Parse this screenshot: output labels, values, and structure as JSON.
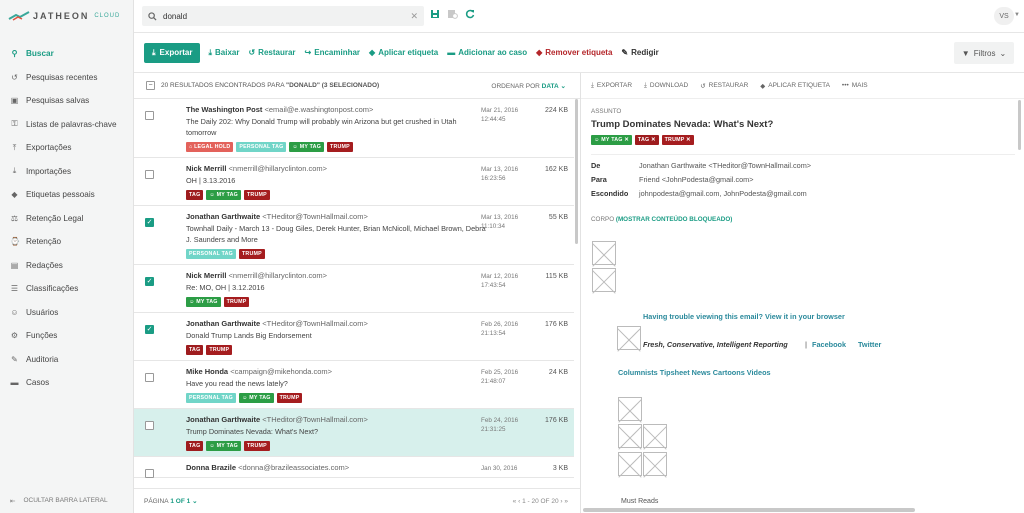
{
  "app": {
    "brand": "JATHEON",
    "brand_sub": "CLOUD",
    "accent": "#1a9c84"
  },
  "sidebar": {
    "items": [
      {
        "label": "Buscar",
        "icon": "search-icon",
        "active": true
      },
      {
        "label": "Pesquisas recentes",
        "icon": "history-icon"
      },
      {
        "label": "Pesquisas salvas",
        "icon": "save-icon"
      },
      {
        "label": "Listas de palavras-chave",
        "icon": "key-icon"
      },
      {
        "label": "Exportações",
        "icon": "export-icon"
      },
      {
        "label": "Importações",
        "icon": "import-icon"
      },
      {
        "label": "Etiquetas pessoais",
        "icon": "tag-icon"
      },
      {
        "label": "Retenção Legal",
        "icon": "legal-hold-icon"
      },
      {
        "label": "Retenção",
        "icon": "retention-icon"
      },
      {
        "label": "Redações",
        "icon": "redaction-icon"
      },
      {
        "label": "Classificações",
        "icon": "classification-icon"
      },
      {
        "label": "Usuários",
        "icon": "users-icon"
      },
      {
        "label": "Funções",
        "icon": "roles-icon"
      },
      {
        "label": "Auditoria",
        "icon": "audit-icon"
      },
      {
        "label": "Casos",
        "icon": "folder-icon"
      }
    ],
    "hide_label": "OCULTAR BARRA LATERAL"
  },
  "search": {
    "value": "donald"
  },
  "user": {
    "initials": "VS"
  },
  "toolbar": {
    "export": "Exportar",
    "download": "Baixar",
    "restore": "Restaurar",
    "forward": "Encaminhar",
    "apply_tag": "Aplicar etiqueta",
    "add_case": "Adicionar ao caso",
    "remove_tag": "Remover etiqueta",
    "compose": "Redigir",
    "filters": "Filtros"
  },
  "list": {
    "summary_prefix": "20 RESULTADOS ENCONTRADOS PARA",
    "query": "\"DONALD\"",
    "summary_suffix": "(3 SELECIONADO)",
    "sort_prefix": "ORDENAR POR",
    "sort_field": "DATA",
    "rows": [
      {
        "name": "The Washington Post",
        "email": "<email@e.washingtonpost.com>",
        "subject": "The Daily 202: Why Donald Trump will probably win Arizona but get crushed in Utah tomorrow",
        "date": "Mar 21, 2016",
        "time": "12:44:45",
        "size": "224 KB",
        "checked": false,
        "selected": false,
        "tags": [
          {
            "l": "LEGAL HOLD",
            "c": "hold",
            "i": "⌂ "
          },
          {
            "l": "PERSONAL TAG",
            "c": "personal",
            "i": ""
          },
          {
            "l": "MY TAG",
            "c": "my",
            "i": "☺ "
          },
          {
            "l": "TRUMP",
            "c": "trump",
            "i": ""
          }
        ]
      },
      {
        "name": "Nick Merrill",
        "email": "<nmerrill@hillaryclinton.com>",
        "subject": "OH | 3.13.2016",
        "date": "Mar 13, 2016",
        "time": "16:23:56",
        "size": "162 KB",
        "checked": false,
        "selected": false,
        "tags": [
          {
            "l": "TAG",
            "c": "gen",
            "i": ""
          },
          {
            "l": "MY TAG",
            "c": "my",
            "i": "☺ "
          },
          {
            "l": "TRUMP",
            "c": "trump",
            "i": ""
          }
        ]
      },
      {
        "name": "Jonathan Garthwaite",
        "email": "<THeditor@TownHallmail.com>",
        "subject": "Townhall Daily - March 13 - Doug Giles, Derek Hunter, Brian McNicoll, Michael Brown, Debra J. Saunders and More",
        "date": "Mar 13, 2016",
        "time": "11:10:34",
        "size": "55 KB",
        "checked": true,
        "selected": false,
        "tags": [
          {
            "l": "PERSONAL TAG",
            "c": "personal",
            "i": ""
          },
          {
            "l": "TRUMP",
            "c": "trump",
            "i": ""
          }
        ]
      },
      {
        "name": "Nick Merrill",
        "email": "<nmerrill@hillaryclinton.com>",
        "subject": "Re: MO, OH | 3.12.2016",
        "date": "Mar 12, 2016",
        "time": "17:43:54",
        "size": "115 KB",
        "checked": true,
        "selected": false,
        "tags": [
          {
            "l": "MY TAG",
            "c": "my",
            "i": "☺ "
          },
          {
            "l": "TRUMP",
            "c": "trump",
            "i": ""
          }
        ]
      },
      {
        "name": "Jonathan Garthwaite",
        "email": "<THeditor@TownHallmail.com>",
        "subject": "Donald Trump Lands Big Endorsement",
        "date": "Feb 26, 2016",
        "time": "21:13:54",
        "size": "176 KB",
        "checked": true,
        "selected": false,
        "tags": [
          {
            "l": "TAG",
            "c": "gen",
            "i": ""
          },
          {
            "l": "TRUMP",
            "c": "trump",
            "i": ""
          }
        ]
      },
      {
        "name": "Mike Honda",
        "email": "<campaign@mikehonda.com>",
        "subject": "Have you read the news lately?",
        "date": "Feb 25, 2016",
        "time": "21:48:07",
        "size": "24 KB",
        "checked": false,
        "selected": false,
        "tags": [
          {
            "l": "PERSONAL TAG",
            "c": "personal",
            "i": ""
          },
          {
            "l": "MY TAG",
            "c": "my",
            "i": "☺ "
          },
          {
            "l": "TRUMP",
            "c": "trump",
            "i": ""
          }
        ]
      },
      {
        "name": "Jonathan Garthwaite",
        "email": "<THeditor@TownHallmail.com>",
        "subject": "Trump Dominates Nevada: What's Next?",
        "date": "Feb 24, 2016",
        "time": "21:31:25",
        "size": "176 KB",
        "checked": false,
        "selected": true,
        "tags": [
          {
            "l": "TAG",
            "c": "gen",
            "i": ""
          },
          {
            "l": "MY TAG",
            "c": "my",
            "i": "☺ "
          },
          {
            "l": "TRUMP",
            "c": "trump",
            "i": ""
          }
        ]
      },
      {
        "name": "Donna Brazile",
        "email": "<donna@brazileassociates.com>",
        "subject": "",
        "date": "Jan 30, 2016",
        "time": "",
        "size": "3 KB",
        "checked": false,
        "selected": false,
        "tags": []
      }
    ]
  },
  "footer": {
    "page_prefix": "PÁGINA",
    "page_value": "1 OF 1",
    "range": "1 - 20 OF 20"
  },
  "detail": {
    "actions": {
      "export": "EXPORTAR",
      "download": "DOWNLOAD",
      "restore": "RESTAURAR",
      "apply_tag": "APLICAR ETIQUETA",
      "more": "MAIS"
    },
    "subject_label": "ASSUNTO",
    "subject": "Trump Dominates Nevada: What's Next?",
    "tags": [
      {
        "l": "MY TAG",
        "c": "my",
        "i": "☺ "
      },
      {
        "l": "TAG",
        "c": "gen",
        "i": ""
      },
      {
        "l": "TRUMP",
        "c": "trump",
        "i": ""
      }
    ],
    "from_label": "De",
    "from": "Jonathan Garthwaite <THeditor@TownHallmail.com>",
    "to_label": "Para",
    "to": "Friend <JohnPodesta@gmail.com>",
    "cc_label": "Escondido",
    "cc": "johnpodesta@gmail.com, JohnPodesta@gmail.com",
    "body_label": "CORPO",
    "body_link": "(MOSTRAR CONTEÚDO BLOQUEADO)",
    "trouble": "Having trouble viewing this email? View it in your browser",
    "fresh": "Fresh, Conservative, Intelligent Reporting",
    "pipe": "|",
    "facebook": "Facebook",
    "twitter": "Twitter",
    "sections": "Columnists Tipsheet News Cartoons Videos",
    "must": "Must Reads"
  }
}
